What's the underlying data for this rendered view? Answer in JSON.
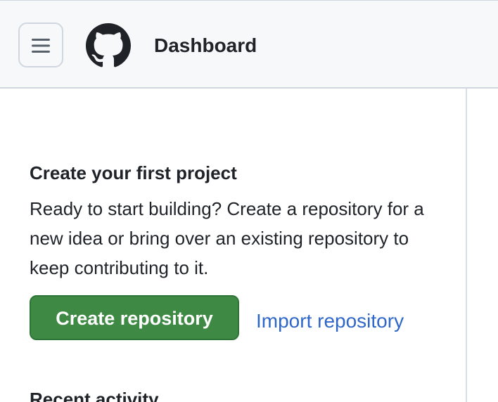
{
  "header": {
    "menu_icon": "hamburger-menu-icon",
    "logo_icon": "github-octocat-icon",
    "title": "Dashboard"
  },
  "main": {
    "first_project": {
      "title": "Create your first project",
      "description": "Ready to start building? Create a repository for a new idea or bring over an existing repository to keep contributing to it.",
      "create_button_label": "Create repository",
      "import_link_label": "Import repository"
    },
    "recent_activity": {
      "title": "Recent activity"
    }
  },
  "colors": {
    "primary_button": "#3e8a45",
    "link": "#2f67c9",
    "header_background": "#f6f8fa"
  }
}
